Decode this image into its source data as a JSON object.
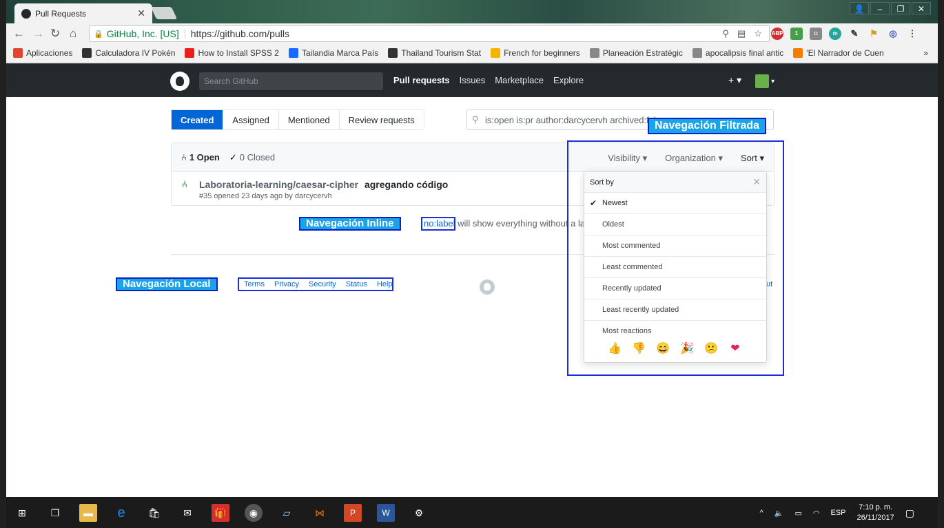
{
  "browser": {
    "tab_title": "Pull Requests",
    "security_label": "GitHub, Inc. [US]",
    "url": "https://github.com/pulls",
    "bookmarks": [
      {
        "label": "Aplicaciones",
        "icon": "apps-grid-icon",
        "color": "#e0462f"
      },
      {
        "label": "Calculadora IV Pokén",
        "icon": "power-icon",
        "color": "#333333"
      },
      {
        "label": "How to Install SPSS 2",
        "icon": "youtube-icon",
        "color": "#e62117"
      },
      {
        "label": "Tailandia Marca País",
        "icon": "behance-icon",
        "color": "#1769ff"
      },
      {
        "label": "Thailand Tourism Stat",
        "icon": "sheet-icon",
        "color": "#333333"
      },
      {
        "label": "French for beginners",
        "icon": "drive-icon",
        "color": "#f4b400"
      },
      {
        "label": "Planeación Estratégic",
        "icon": "page-icon",
        "color": "#888888"
      },
      {
        "label": "apocalipsis final antic",
        "icon": "page-icon",
        "color": "#888888"
      },
      {
        "label": "'El Narrador de Cuen",
        "icon": "avast-icon",
        "color": "#f57c00"
      }
    ],
    "more_label": "»"
  },
  "github": {
    "search_placeholder": "Search GitHub",
    "nav": [
      "Pull requests",
      "Issues",
      "Marketplace",
      "Explore"
    ],
    "plus_label": "+ ▾",
    "avatar_caret": "▾"
  },
  "subnav": [
    "Created",
    "Assigned",
    "Mentioned",
    "Review requests"
  ],
  "filter_query": "is:open is:pr author:darcycervh archived:fals",
  "states": {
    "open": "1 Open",
    "closed": "0 Closed"
  },
  "filters": {
    "visibility": "Visibility ▾",
    "organization": "Organization ▾",
    "sort": "Sort ▾"
  },
  "pr": {
    "repo": "Laboratoria-learning/caesar-cipher",
    "title": "agregando código",
    "meta": "#35 opened 23 days ago by darcycervh"
  },
  "tip": {
    "code": "no:label",
    "text": " will show everything without a lab"
  },
  "footer": {
    "links": [
      "Terms",
      "Privacy",
      "Security",
      "Status",
      "Help"
    ],
    "about": "ut"
  },
  "sort_menu": {
    "header": "Sort by",
    "items": [
      "Newest",
      "Oldest",
      "Most commented",
      "Least commented",
      "Recently updated",
      "Least recently updated",
      "Most reactions"
    ],
    "selected": "Newest",
    "reactions": [
      "👍",
      "👎",
      "😄",
      "🎉",
      "😕",
      "❤"
    ]
  },
  "annotations": {
    "filtrada": "Navegación Filtrada",
    "inline": "Navegación Inline",
    "local": "Navegación Local"
  },
  "taskbar": {
    "language": "ESP",
    "time": "7:10 p. m.",
    "date": "26/11/2017"
  },
  "colors": {
    "accent": "#0366d6",
    "annotation_fill": "#1aa3e8",
    "annotation_border": "#0b20c8",
    "header": "#24292e"
  }
}
